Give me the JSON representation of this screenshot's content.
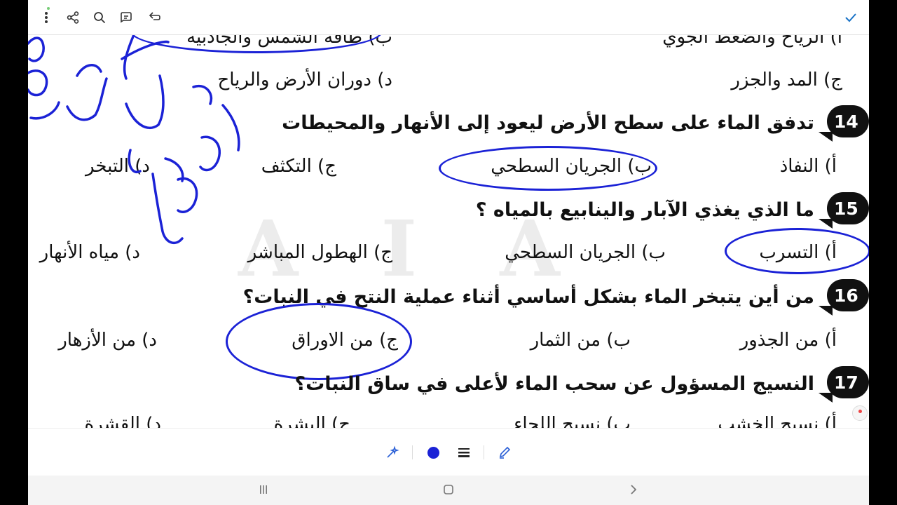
{
  "toolbar": {
    "icons": [
      "more-vert-icon",
      "share-icon",
      "search-icon",
      "chat-icon",
      "undo-icon",
      "check-icon"
    ]
  },
  "watermark": {
    "text": "A I A"
  },
  "questions": [
    {
      "number": "",
      "text": "",
      "options": [
        {
          "label": "أ) الرياح والضغط الجوي",
          "circled": false
        },
        {
          "label": "ب) طاقة الشمس والجاذبية",
          "circled": true
        },
        {
          "label": "ج) المد والجزر",
          "circled": false
        },
        {
          "label": "د) دوران الأرض والرياح",
          "circled": false
        }
      ]
    },
    {
      "number": "14",
      "text": "تدفق الماء على سطح الأرض ليعود إلى الأنهار والمحيطات",
      "options": [
        {
          "label": "أ) النفاذ",
          "circled": false
        },
        {
          "label": "ب) الجريان السطحي",
          "circled": true
        },
        {
          "label": "ج) التكثف",
          "circled": false
        },
        {
          "label": "د) التبخر",
          "circled": false
        }
      ]
    },
    {
      "number": "15",
      "text": "ما الذي يغذي الآبار والينابيع بالمياه ؟",
      "options": [
        {
          "label": "أ) التسرب",
          "circled": true
        },
        {
          "label": "ب) الجريان السطحي",
          "circled": false
        },
        {
          "label": "ج) الهطول المباشر",
          "circled": false
        },
        {
          "label": "د) مياه الأنهار",
          "circled": false
        }
      ]
    },
    {
      "number": "16",
      "text": "من أين يتبخر الماء بشكل أساسي أثناء عملية النتح في النبات؟",
      "options": [
        {
          "label": "أ) من الجذور",
          "circled": false
        },
        {
          "label": "ب) من الثمار",
          "circled": false
        },
        {
          "label": "ج) من الاوراق",
          "circled": true
        },
        {
          "label": "د) من الأزهار",
          "circled": false
        }
      ]
    },
    {
      "number": "17",
      "text": "النسيج المسؤول عن سحب الماء لأعلى في ساق النبات؟",
      "options": [
        {
          "label": "أ) نسيج الخشب",
          "circled": false
        },
        {
          "label": "ب) نسيج اللحاء",
          "circled": false
        },
        {
          "label": "ج) البشرة",
          "circled": false
        },
        {
          "label": "د) القشرة",
          "circled": false
        }
      ]
    }
  ],
  "ink": {
    "color": "#1b22d6"
  },
  "bottom_tools": {
    "icons": [
      "magic-pen-icon",
      "color-dot-icon",
      "line-weight-icon",
      "pen-icon"
    ],
    "active_color": "#1b22d6"
  },
  "navbar": {
    "icons": [
      "recents-icon",
      "home-icon",
      "back-icon"
    ]
  }
}
